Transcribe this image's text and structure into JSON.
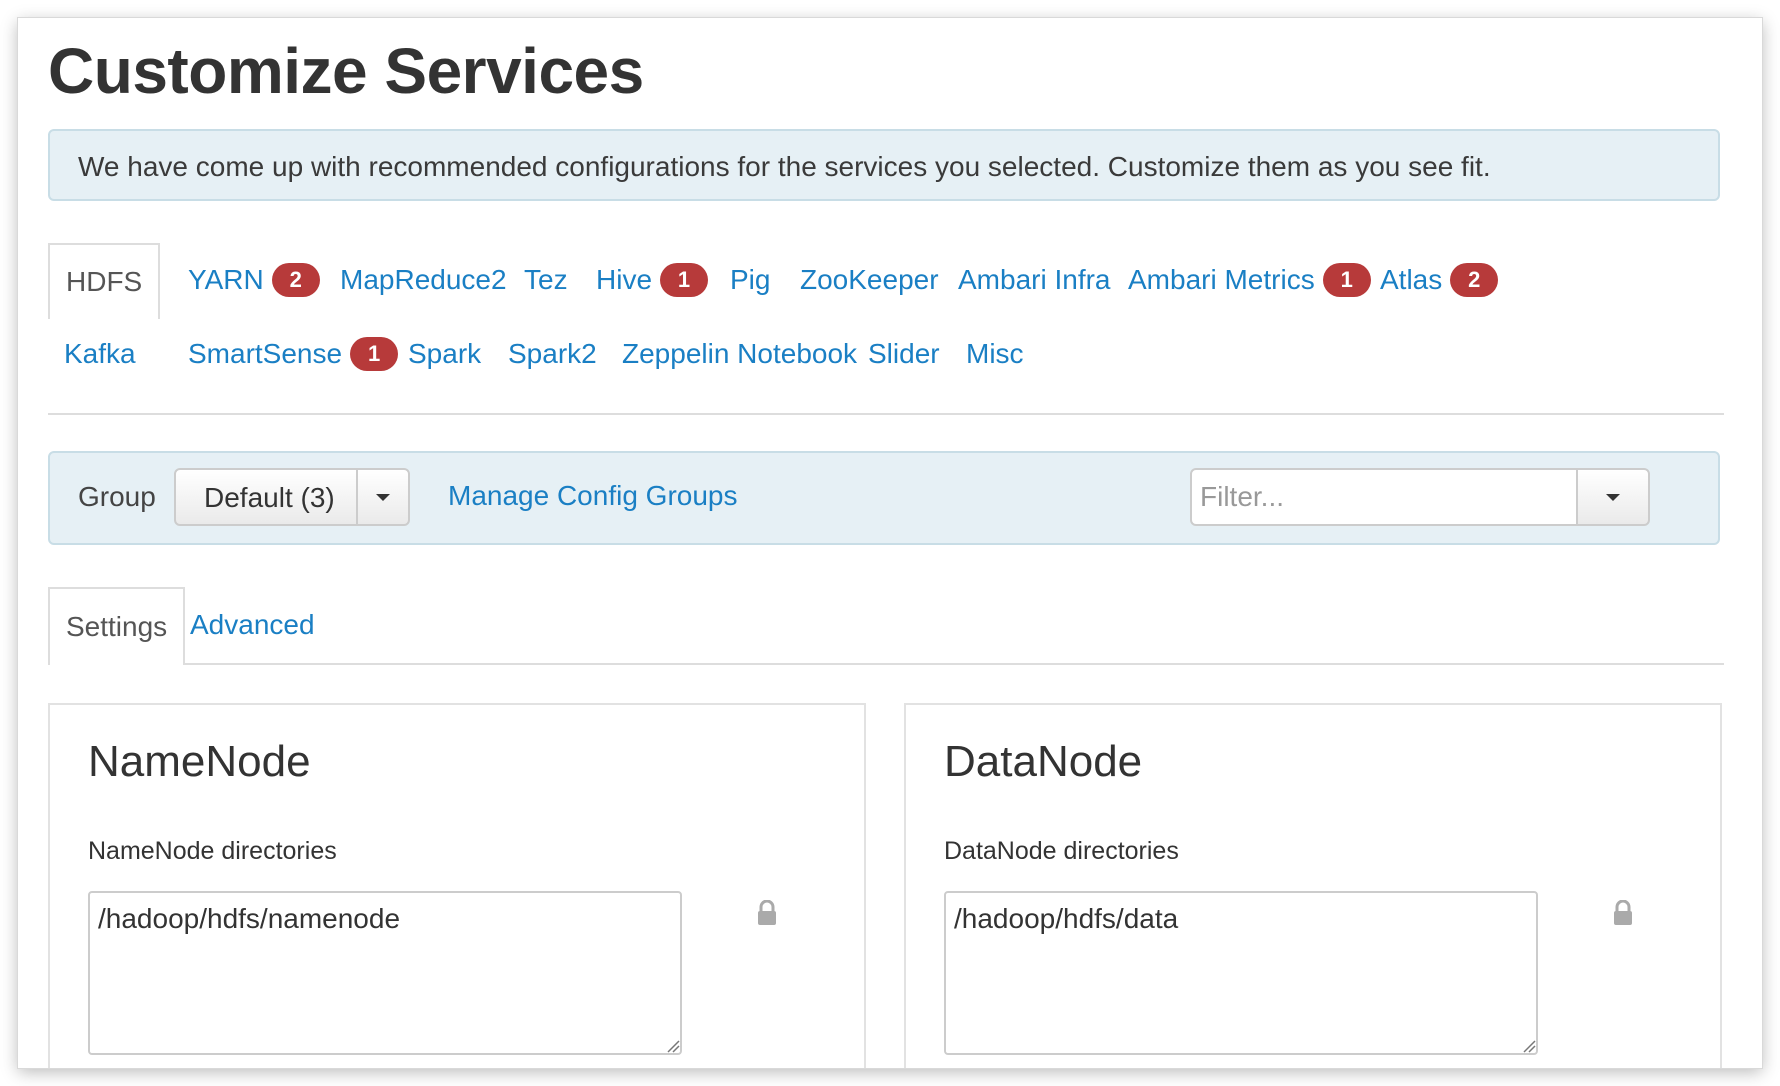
{
  "page": {
    "title": "Customize Services",
    "alert": "We have come up with recommended configurations for the services you selected. Customize them as you see fit."
  },
  "service_tabs": [
    {
      "label": "HDFS",
      "badge": null,
      "active": true
    },
    {
      "label": "YARN",
      "badge": "2"
    },
    {
      "label": "MapReduce2",
      "badge": null
    },
    {
      "label": "Tez",
      "badge": null
    },
    {
      "label": "Hive",
      "badge": "1"
    },
    {
      "label": "Pig",
      "badge": null
    },
    {
      "label": "ZooKeeper",
      "badge": null
    },
    {
      "label": "Ambari Infra",
      "badge": null
    },
    {
      "label": "Ambari Metrics",
      "badge": "1"
    },
    {
      "label": "Atlas",
      "badge": "2"
    },
    {
      "label": "Kafka",
      "badge": null
    },
    {
      "label": "SmartSense",
      "badge": "1"
    },
    {
      "label": "Spark",
      "badge": null
    },
    {
      "label": "Spark2",
      "badge": null
    },
    {
      "label": "Zeppelin Notebook",
      "badge": null
    },
    {
      "label": "Slider",
      "badge": null
    },
    {
      "label": "Misc",
      "badge": null
    }
  ],
  "toolbar": {
    "group_label": "Group",
    "group_value": "Default (3)",
    "manage_link": "Manage Config Groups",
    "filter_placeholder": "Filter..."
  },
  "sub_tabs": [
    {
      "label": "Settings",
      "active": true
    },
    {
      "label": "Advanced"
    }
  ],
  "panels": [
    {
      "title": "NameNode",
      "field_label": "NameNode directories",
      "value": "/hadoop/hdfs/namenode"
    },
    {
      "title": "DataNode",
      "field_label": "DataNode directories",
      "value": "/hadoop/hdfs/data"
    }
  ],
  "colors": {
    "link": "#1a7fc4",
    "badge": "#b73a3a",
    "alert_bg": "#e6f0f5"
  }
}
